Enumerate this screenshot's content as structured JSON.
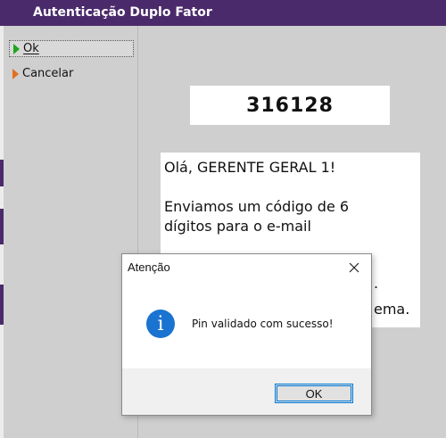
{
  "window": {
    "title": "Autenticação Duplo Fator"
  },
  "menu": {
    "ok_label": "Ok",
    "cancel_label": "Cancelar"
  },
  "code": "316128",
  "message": {
    "greeting": "Olá, GERENTE GERAL 1!",
    "line1": "Enviamos um código de 6",
    "line2": "dígitos para o e-mail",
    "frag1": ".",
    "frag2": "ema."
  },
  "dialog": {
    "title": "Atenção",
    "text": "Pin validado com sucesso!",
    "ok_label": "OK",
    "icon": "info-icon"
  },
  "colors": {
    "titlebar": "#4a2a6b",
    "info": "#1a73d0",
    "focus": "#0078d7"
  }
}
